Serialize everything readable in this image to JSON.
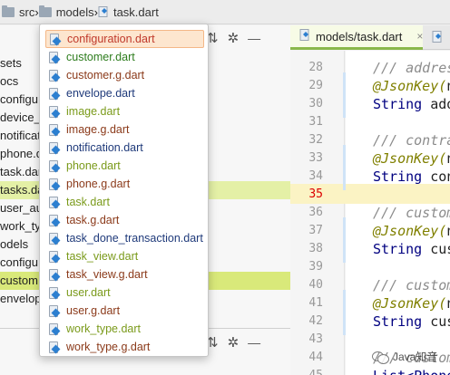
{
  "breadcrumb": {
    "items": [
      {
        "label": "src",
        "icon": "folder-icon"
      },
      {
        "label": "models",
        "icon": "folder-icon"
      },
      {
        "label": "task.dart",
        "icon": "dart-file-icon"
      }
    ],
    "separator": "›"
  },
  "tree": {
    "toolbar": {
      "collapse_icon": "collapse-all-icon",
      "settings_icon": "gear-icon",
      "hide_icon": "minimize-icon"
    },
    "rows": [
      {
        "label": "sets"
      },
      {
        "label": "ocs"
      },
      {
        "label": "configu"
      },
      {
        "label": "device_"
      },
      {
        "label": "notificat"
      },
      {
        "label": "phone.d"
      },
      {
        "label": "task.dar"
      },
      {
        "label": "tasks.da"
      },
      {
        "label": "user_au"
      },
      {
        "label": "work_ty"
      },
      {
        "label": "odels"
      },
      {
        "label": "configu"
      },
      {
        "label": "custom"
      },
      {
        "label": "envelop"
      }
    ]
  },
  "editor": {
    "tab_label": "models/task.dart",
    "tab_close": "×",
    "active_line": "35",
    "lines": [
      {
        "n": "28",
        "parts": [
          {
            "t": "/// addres",
            "c": "comment"
          }
        ]
      },
      {
        "n": "29",
        "parts": [
          {
            "t": "@JsonKey(",
            "c": "anno"
          },
          {
            "t": "n",
            "c": ""
          }
        ]
      },
      {
        "n": "30",
        "parts": [
          {
            "t": "String",
            "c": "kw"
          },
          {
            "t": " add",
            "c": ""
          }
        ]
      },
      {
        "n": "31",
        "parts": []
      },
      {
        "n": "32",
        "parts": [
          {
            "t": "/// contra",
            "c": "comment"
          }
        ]
      },
      {
        "n": "33",
        "parts": [
          {
            "t": "@JsonKey(",
            "c": "anno"
          },
          {
            "t": "n",
            "c": ""
          }
        ]
      },
      {
        "n": "34",
        "parts": [
          {
            "t": "String",
            "c": "kw"
          },
          {
            "t": " con",
            "c": ""
          }
        ]
      },
      {
        "n": "35",
        "parts": []
      },
      {
        "n": "36",
        "parts": [
          {
            "t": "/// custom",
            "c": "comment"
          }
        ]
      },
      {
        "n": "37",
        "parts": [
          {
            "t": "@JsonKey(",
            "c": "anno"
          },
          {
            "t": "n",
            "c": ""
          }
        ]
      },
      {
        "n": "38",
        "parts": [
          {
            "t": "String",
            "c": "kw"
          },
          {
            "t": " cus",
            "c": ""
          }
        ]
      },
      {
        "n": "39",
        "parts": []
      },
      {
        "n": "40",
        "parts": [
          {
            "t": "/// custom",
            "c": "comment"
          }
        ]
      },
      {
        "n": "41",
        "parts": [
          {
            "t": "@JsonKey(",
            "c": "anno"
          },
          {
            "t": "n",
            "c": ""
          }
        ]
      },
      {
        "n": "42",
        "parts": [
          {
            "t": "String",
            "c": "kw"
          },
          {
            "t": " cus",
            "c": ""
          }
        ]
      },
      {
        "n": "43",
        "parts": []
      },
      {
        "n": "44",
        "parts": [
          {
            "t": "/// custom",
            "c": "comment"
          }
        ]
      },
      {
        "n": "45",
        "parts": [
          {
            "t": "List<Phone",
            "c": "kw"
          }
        ]
      }
    ]
  },
  "popup": {
    "items": [
      {
        "label": "configuration.dart",
        "color": "#c0392b",
        "selected": true
      },
      {
        "label": "customer.dart",
        "color": "#2e7d1e"
      },
      {
        "label": "customer.g.dart",
        "color": "#8b3a1a"
      },
      {
        "label": "envelope.dart",
        "color": "#1f3a7a"
      },
      {
        "label": "image.dart",
        "color": "#7a9a1a"
      },
      {
        "label": "image.g.dart",
        "color": "#8b3a1a"
      },
      {
        "label": "notification.dart",
        "color": "#1f3a7a"
      },
      {
        "label": "phone.dart",
        "color": "#7a9a1a"
      },
      {
        "label": "phone.g.dart",
        "color": "#8b3a1a"
      },
      {
        "label": "task.dart",
        "color": "#7a9a1a"
      },
      {
        "label": "task.g.dart",
        "color": "#8b3a1a"
      },
      {
        "label": "task_done_transaction.dart",
        "color": "#1f3a7a"
      },
      {
        "label": "task_view.dart",
        "color": "#7a9a1a"
      },
      {
        "label": "task_view.g.dart",
        "color": "#8b3a1a"
      },
      {
        "label": "user.dart",
        "color": "#7a9a1a"
      },
      {
        "label": "user.g.dart",
        "color": "#8b3a1a"
      },
      {
        "label": "work_type.dart",
        "color": "#7a9a1a"
      },
      {
        "label": "work_type.g.dart",
        "color": "#8b3a1a"
      }
    ]
  },
  "watermark": {
    "label": "Java知音"
  }
}
